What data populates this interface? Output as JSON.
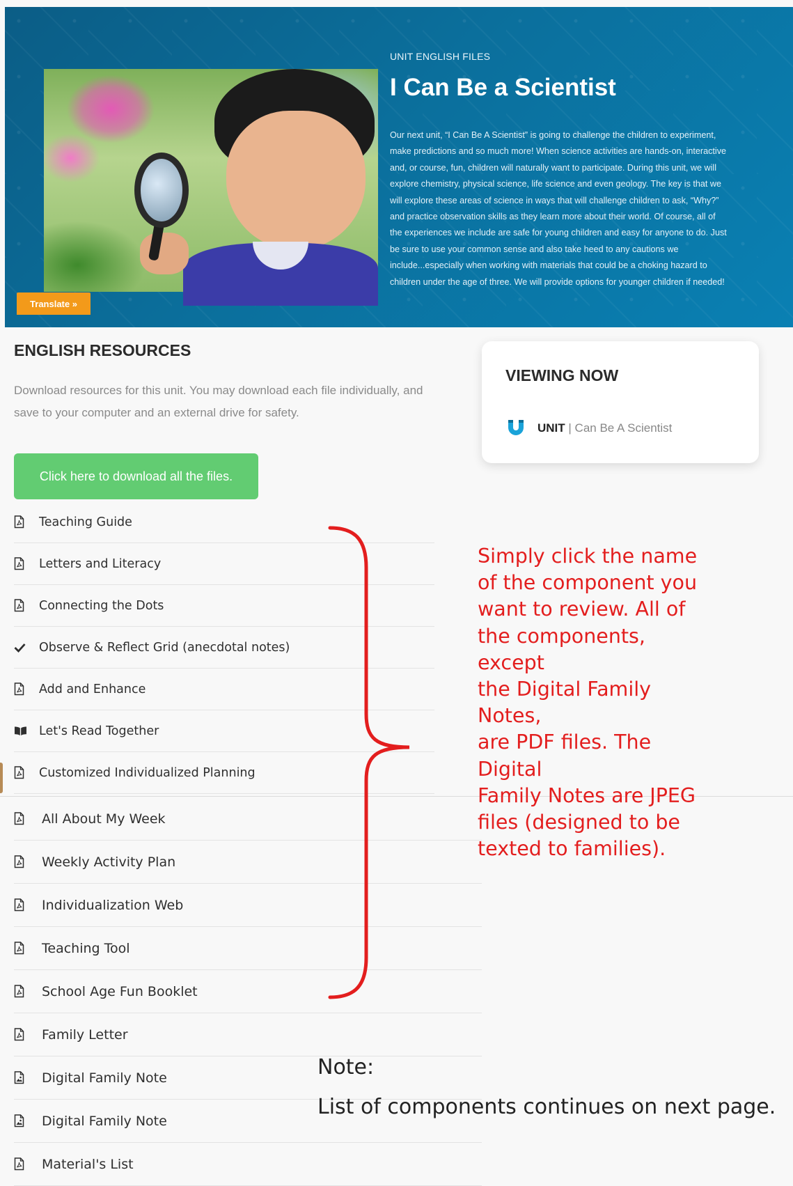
{
  "hero": {
    "kicker": "UNIT ENGLISH FILES",
    "title": "I Can Be a Scientist",
    "description": "Our next unit, “I Can Be A Scientist” is going to challenge the children to experiment, make predictions and so much more! When science activities are hands-on, interactive and, or course, fun, children will naturally want to participate. During this unit, we will explore chemistry, physical science, life science and even geology. The key is that we will explore these areas of science in ways that will challenge children to ask, “Why?” and practice observation skills as they learn more about their world. Of course, all of the experiences we include are safe for young children and easy for anyone to do. Just be sure to use your common sense and also take heed to any cautions we include...especially when working with materials that could be a choking hazard to children under the age of three. We will provide options for younger children if needed!",
    "translate_label": "Translate »"
  },
  "resources": {
    "title": "ENGLISH RESOURCES",
    "description": "Download resources for this unit. You may download each file individually, and save to your computer and an external drive for safety.",
    "download_all_label": "Click here to download all the files."
  },
  "viewing": {
    "title": "VIEWING NOW",
    "unit_label": "UNIT",
    "unit_name": "| Can Be A Scientist"
  },
  "list1": [
    {
      "label": "Teaching Guide",
      "icon": "pdf-icon"
    },
    {
      "label": "Letters and Literacy",
      "icon": "pdf-icon"
    },
    {
      "label": "Connecting the Dots",
      "icon": "pdf-icon"
    },
    {
      "label": "Observe & Reflect Grid (anecdotal notes)",
      "icon": "check-icon"
    },
    {
      "label": "Add and Enhance",
      "icon": "pdf-icon"
    },
    {
      "label": "Let's Read Together",
      "icon": "book-icon"
    },
    {
      "label": "Customized Individualized Planning",
      "icon": "pdf-icon"
    }
  ],
  "list2": [
    {
      "label": "All About My Week",
      "icon": "pdf-icon"
    },
    {
      "label": "Weekly Activity Plan",
      "icon": "pdf-icon"
    },
    {
      "label": "Individualization Web",
      "icon": "pdf-icon"
    },
    {
      "label": "Teaching Tool",
      "icon": "pdf-icon"
    },
    {
      "label": "School Age Fun Booklet",
      "icon": "pdf-icon"
    },
    {
      "label": "Family Letter",
      "icon": "pdf-icon"
    },
    {
      "label": "Digital Family Note",
      "icon": "image-file-icon"
    },
    {
      "label": "Digital Family Note",
      "icon": "image-file-icon"
    },
    {
      "label": "Material's List",
      "icon": "pdf-icon"
    }
  ],
  "annotation": {
    "lines": [
      "Simply click the name",
      "of the component you",
      "want to review. All of",
      "the components, except",
      "the Digital Family Notes,",
      "are PDF files. The Digital",
      "Family Notes are JPEG",
      "files (designed to be",
      "texted to families)."
    ]
  },
  "note": {
    "line1": "Note:",
    "line2": "List of components continues  on next page."
  },
  "colors": {
    "hero_blue": "#0b6f9c",
    "download_green": "#62cc72",
    "translate_orange": "#f39a1a",
    "annotation_red": "#e31e1e",
    "magnet_blue": "#1aa3d9"
  }
}
